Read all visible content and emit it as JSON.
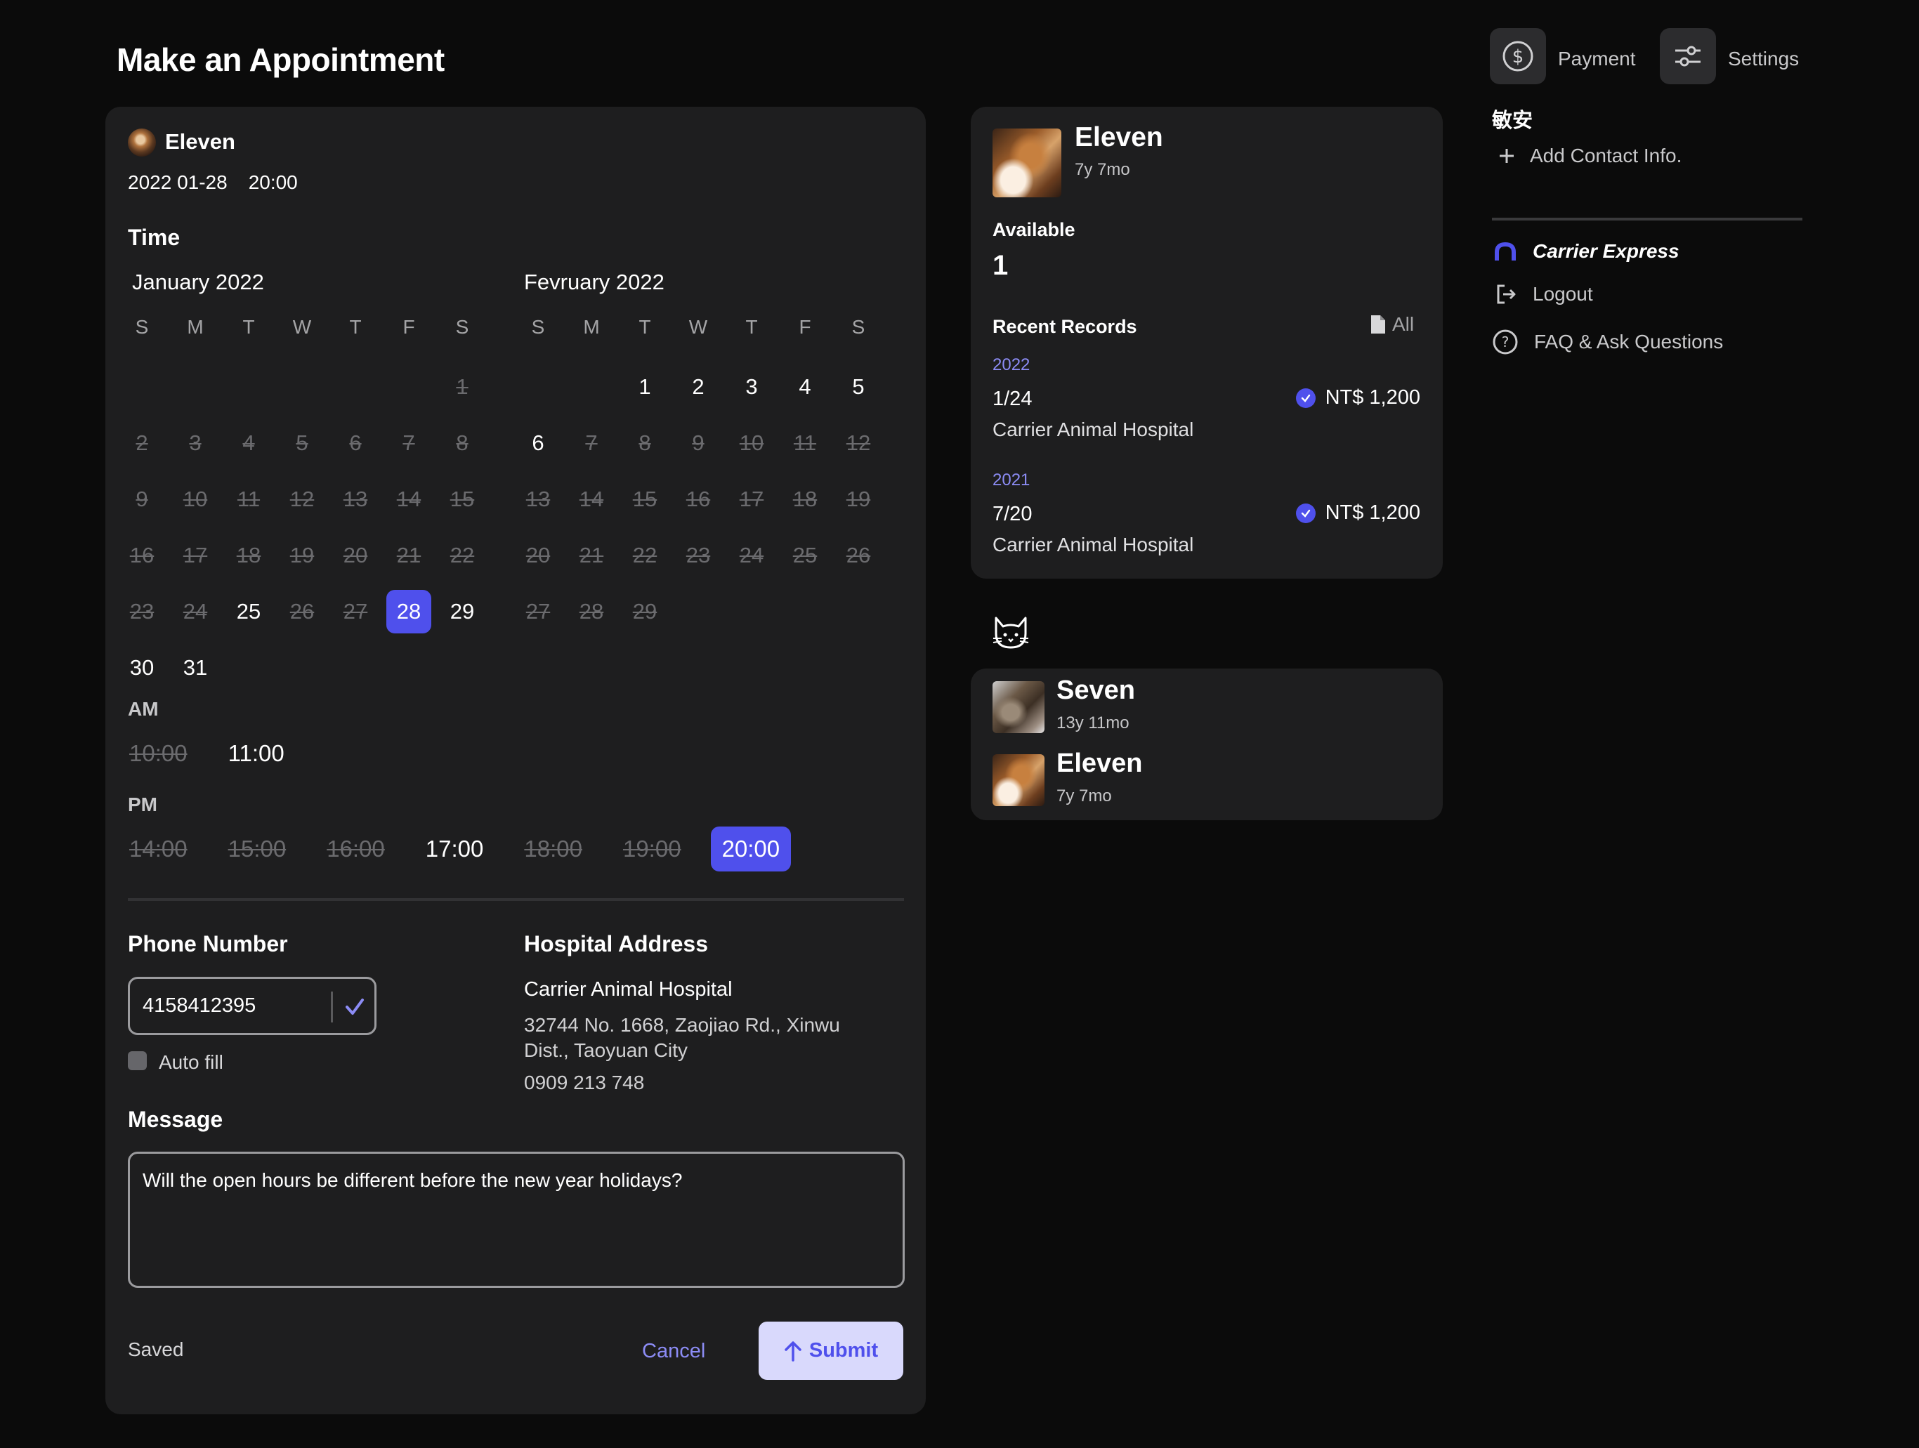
{
  "page": {
    "title": "Make an Appointment"
  },
  "appointment": {
    "pet_name": "Eleven",
    "date": "2022 01-28",
    "time": "20:00",
    "time_section_label": "Time"
  },
  "calendar": {
    "weekday_headers": [
      "S",
      "M",
      "T",
      "W",
      "T",
      "F",
      "S"
    ],
    "months": [
      {
        "title": "January 2022",
        "days": [
          {
            "d": "",
            "s": "empty"
          },
          {
            "d": "",
            "s": "empty"
          },
          {
            "d": "",
            "s": "empty"
          },
          {
            "d": "",
            "s": "empty"
          },
          {
            "d": "",
            "s": "empty"
          },
          {
            "d": "",
            "s": "empty"
          },
          {
            "d": "1",
            "s": "disabled"
          },
          {
            "d": "2",
            "s": "disabled"
          },
          {
            "d": "3",
            "s": "disabled"
          },
          {
            "d": "4",
            "s": "disabled"
          },
          {
            "d": "5",
            "s": "disabled"
          },
          {
            "d": "6",
            "s": "disabled"
          },
          {
            "d": "7",
            "s": "disabled"
          },
          {
            "d": "8",
            "s": "disabled"
          },
          {
            "d": "9",
            "s": "disabled"
          },
          {
            "d": "10",
            "s": "disabled"
          },
          {
            "d": "11",
            "s": "disabled"
          },
          {
            "d": "12",
            "s": "disabled"
          },
          {
            "d": "13",
            "s": "disabled"
          },
          {
            "d": "14",
            "s": "disabled"
          },
          {
            "d": "15",
            "s": "disabled"
          },
          {
            "d": "16",
            "s": "disabled"
          },
          {
            "d": "17",
            "s": "disabled"
          },
          {
            "d": "18",
            "s": "disabled"
          },
          {
            "d": "19",
            "s": "disabled"
          },
          {
            "d": "20",
            "s": "disabled"
          },
          {
            "d": "21",
            "s": "disabled"
          },
          {
            "d": "22",
            "s": "disabled"
          },
          {
            "d": "23",
            "s": "disabled"
          },
          {
            "d": "24",
            "s": "disabled"
          },
          {
            "d": "25",
            "s": "enabled"
          },
          {
            "d": "26",
            "s": "disabled"
          },
          {
            "d": "27",
            "s": "disabled"
          },
          {
            "d": "28",
            "s": "selected"
          },
          {
            "d": "29",
            "s": "enabled"
          },
          {
            "d": "30",
            "s": "enabled"
          },
          {
            "d": "31",
            "s": "enabled"
          }
        ]
      },
      {
        "title": "Fevruary 2022",
        "days": [
          {
            "d": "",
            "s": "empty"
          },
          {
            "d": "",
            "s": "empty"
          },
          {
            "d": "1",
            "s": "enabled"
          },
          {
            "d": "2",
            "s": "enabled"
          },
          {
            "d": "3",
            "s": "enabled"
          },
          {
            "d": "4",
            "s": "enabled"
          },
          {
            "d": "5",
            "s": "enabled"
          },
          {
            "d": "6",
            "s": "enabled"
          },
          {
            "d": "7",
            "s": "disabled"
          },
          {
            "d": "8",
            "s": "disabled"
          },
          {
            "d": "9",
            "s": "disabled"
          },
          {
            "d": "10",
            "s": "disabled"
          },
          {
            "d": "11",
            "s": "disabled"
          },
          {
            "d": "12",
            "s": "disabled"
          },
          {
            "d": "13",
            "s": "disabled"
          },
          {
            "d": "14",
            "s": "disabled"
          },
          {
            "d": "15",
            "s": "disabled"
          },
          {
            "d": "16",
            "s": "disabled"
          },
          {
            "d": "17",
            "s": "disabled"
          },
          {
            "d": "18",
            "s": "disabled"
          },
          {
            "d": "19",
            "s": "disabled"
          },
          {
            "d": "20",
            "s": "disabled"
          },
          {
            "d": "21",
            "s": "disabled"
          },
          {
            "d": "22",
            "s": "disabled"
          },
          {
            "d": "23",
            "s": "disabled"
          },
          {
            "d": "24",
            "s": "disabled"
          },
          {
            "d": "25",
            "s": "disabled"
          },
          {
            "d": "26",
            "s": "disabled"
          },
          {
            "d": "27",
            "s": "disabled"
          },
          {
            "d": "28",
            "s": "disabled"
          },
          {
            "d": "29",
            "s": "disabled"
          }
        ]
      }
    ]
  },
  "time_slots": {
    "am_label": "AM",
    "pm_label": "PM",
    "am": [
      {
        "t": "10:00",
        "s": "disabled"
      },
      {
        "t": "11:00",
        "s": "enabled"
      }
    ],
    "pm": [
      {
        "t": "14:00",
        "s": "disabled"
      },
      {
        "t": "15:00",
        "s": "disabled"
      },
      {
        "t": "16:00",
        "s": "disabled"
      },
      {
        "t": "17:00",
        "s": "enabled"
      },
      {
        "t": "18:00",
        "s": "disabled"
      },
      {
        "t": "19:00",
        "s": "disabled"
      },
      {
        "t": "20:00",
        "s": "selected"
      }
    ]
  },
  "phone": {
    "label": "Phone Number",
    "value": "4158412395",
    "autofill_label": "Auto fill",
    "autofill_checked": false
  },
  "hospital": {
    "label": "Hospital Address",
    "name": "Carrier Animal Hospital",
    "address": "32744 No. 1668, Zaojiao Rd., Xinwu Dist., Taoyuan City",
    "phone": "0909 213 748"
  },
  "message": {
    "label": "Message",
    "value": "Will the open hours be different before the new year holidays?"
  },
  "footer": {
    "status": "Saved",
    "cancel_label": "Cancel",
    "submit_label": "Submit"
  },
  "pet_card": {
    "name": "Eleven",
    "age": "7y 7mo",
    "available_label": "Available",
    "available_count": "1",
    "recent_label": "Recent Records",
    "all_label": "All",
    "records": [
      {
        "year": "2022",
        "date": "1/24",
        "hospital": "Carrier Animal Hospital",
        "price": "NT$ 1,200"
      },
      {
        "year": "2021",
        "date": "7/20",
        "hospital": "Carrier Animal Hospital",
        "price": "NT$ 1,200"
      }
    ]
  },
  "pet_list": [
    {
      "name": "Seven",
      "age": "13y 11mo"
    },
    {
      "name": "Eleven",
      "age": "7y 7mo"
    }
  ],
  "nav": {
    "payment_label": "Payment",
    "settings_label": "Settings",
    "user_name": "敏安",
    "add_contact_label": "Add Contact Info.",
    "items": [
      {
        "label": "Carrier Express",
        "icon": "carrier-express-icon"
      },
      {
        "label": "Logout",
        "icon": "logout-icon"
      },
      {
        "label": "FAQ & Ask Questions",
        "icon": "question-icon"
      }
    ]
  },
  "colors": {
    "accent": "#4f50ec",
    "accent_light": "#8c8cf5",
    "panel": "#1e1e1f",
    "background": "#0b0b0b",
    "submit_bg": "#d9d9fc"
  }
}
